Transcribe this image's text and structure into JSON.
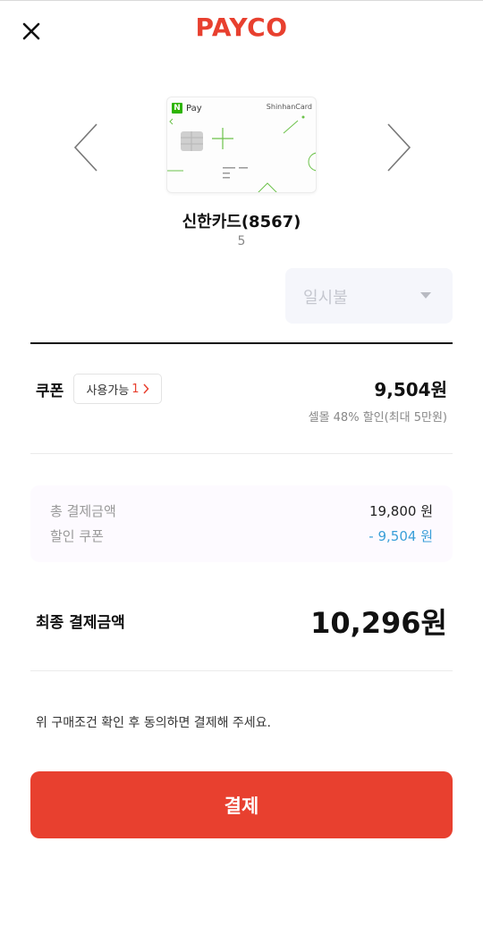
{
  "header": {
    "brand": "PAYCO",
    "close_icon": "close-icon"
  },
  "card_carousel": {
    "prev_icon": "chevron-left-icon",
    "next_icon": "chevron-right-icon",
    "card": {
      "wallet_badge": "N",
      "wallet_label": "Pay",
      "issuer_brand": "ShinhanCard",
      "accent_color": "#2db400"
    },
    "card_name": "신한카드(8567)",
    "card_sub": "5"
  },
  "installment": {
    "selected": "일시불",
    "caret_icon": "caret-down-icon"
  },
  "coupon": {
    "label": "쿠폰",
    "available_label": "사용가능",
    "available_count": "1",
    "amount": "9,504원",
    "description": "셀몰 48% 할인(최대 5만원)"
  },
  "summary": {
    "total_label": "총 결제금액",
    "total_value": "19,800 원",
    "discount_label": "할인 쿠폰",
    "discount_value": "- 9,504 원"
  },
  "final": {
    "label": "최종 결제금액",
    "amount": "10,296원"
  },
  "notice": "위 구매조건 확인 후 동의하면 결제해 주세요.",
  "pay_button": "결제",
  "colors": {
    "brand": "#e8402f",
    "discount": "#3a9fd8"
  }
}
